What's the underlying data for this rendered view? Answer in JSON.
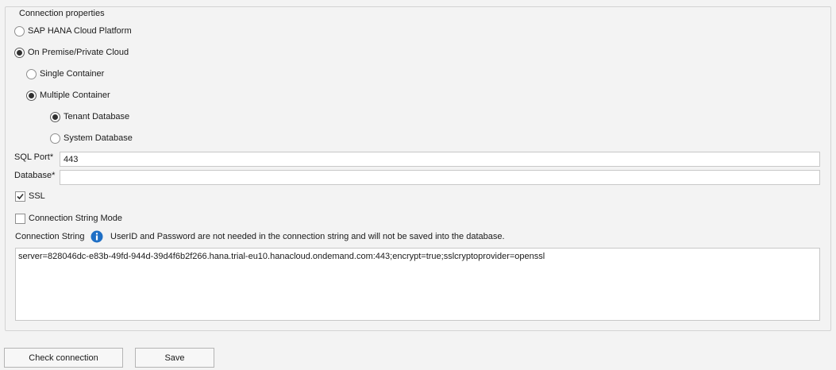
{
  "group": {
    "title": "Connection properties"
  },
  "deployment": {
    "options": [
      {
        "label": "SAP HANA Cloud Platform",
        "checked": false
      },
      {
        "label": "On Premise/Private Cloud",
        "checked": true
      }
    ]
  },
  "container": {
    "options": [
      {
        "label": "Single Container",
        "checked": false
      },
      {
        "label": "Multiple Container",
        "checked": true
      }
    ]
  },
  "database_type": {
    "options": [
      {
        "label": "Tenant Database",
        "checked": true
      },
      {
        "label": "System Database",
        "checked": false
      }
    ]
  },
  "sql_port": {
    "label": "SQL Port*",
    "value": "443"
  },
  "database": {
    "label": "Database*",
    "value": ""
  },
  "ssl": {
    "label": "SSL",
    "checked": true
  },
  "connection_string_mode": {
    "label": "Connection String Mode",
    "checked": false
  },
  "connection_string": {
    "label": "Connection String",
    "info_icon": "info-icon",
    "info_text": "UserID and Password are not needed in the connection string and will not be saved into the database.",
    "value": "server=828046dc-e83b-49fd-944d-39d4f6b2f266.hana.trial-eu10.hanacloud.ondemand.com:443;encrypt=true;sslcryptoprovider=openssl"
  },
  "buttons": {
    "check_connection": "Check connection",
    "save": "Save"
  },
  "colors": {
    "background": "#f3f3f3",
    "info_icon": "#1f6fc5"
  }
}
